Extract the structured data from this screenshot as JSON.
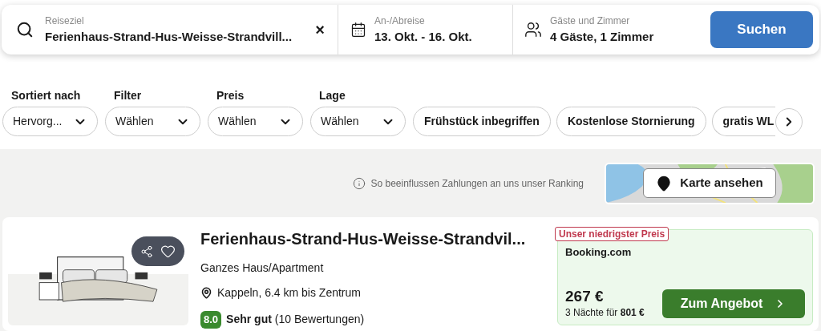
{
  "search_bar": {
    "destination": {
      "label": "Reiseziel",
      "value": "Ferienhaus-Strand-Hus-Weisse-Strandvill..."
    },
    "dates": {
      "label": "An-/Abreise",
      "value": "13. Okt. - 16. Okt."
    },
    "guests": {
      "label": "Gäste und Zimmer",
      "value": "4 Gäste, 1 Zimmer"
    },
    "clear": "×",
    "submit": "Suchen"
  },
  "filters": [
    {
      "label": "Sortiert nach",
      "value": "Hervorg..."
    },
    {
      "label": "Filter",
      "value": "Wählen"
    },
    {
      "label": "Preis",
      "value": "Wählen"
    },
    {
      "label": "Lage",
      "value": "Wählen"
    }
  ],
  "quick_filters": [
    "Frühstück inbegriffen",
    "Kostenlose Stornierung",
    "gratis WL"
  ],
  "ranking_note": "So beeinflussen Zahlungen an uns unser Ranking",
  "map_button": "Karte ansehen",
  "results": [
    {
      "title": "Ferienhaus-Strand-Hus-Weisse-Strandvil...",
      "type": "Ganzes Haus/Apartment",
      "location": "Kappeln, 6.4 km bis Zentrum",
      "score": "8.0",
      "rating": "Sehr gut",
      "reviews": "(10 Bewertungen)",
      "deal": {
        "badge": "Unser niedrigster Preis",
        "provider": "Booking.com",
        "price": "267 €",
        "total": "3 Nächte für **801 €**",
        "button": "Zum Angebot"
      }
    }
  ]
}
